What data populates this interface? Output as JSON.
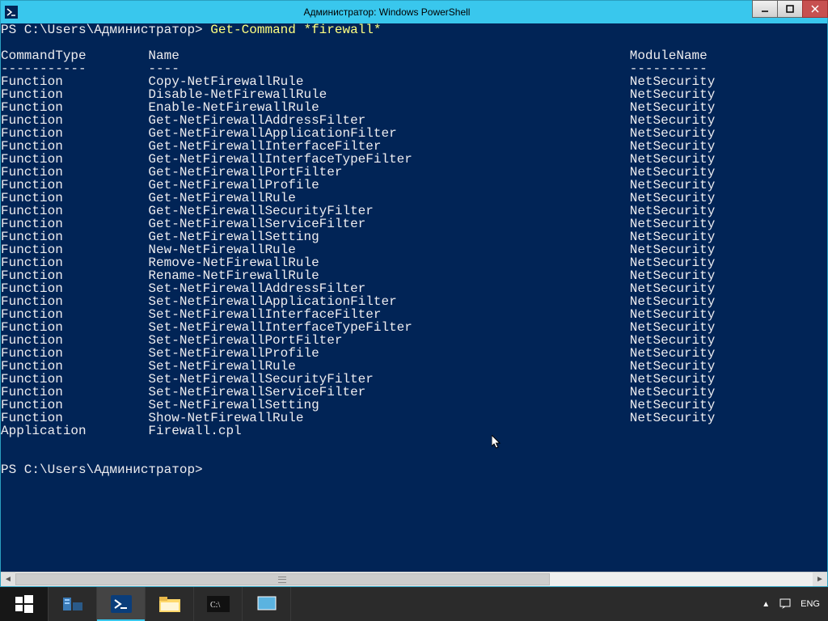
{
  "window": {
    "title": "Администратор: Windows PowerShell"
  },
  "terminal": {
    "prompt": "PS C:\\Users\\Администратор>",
    "command": "Get-Command *firewall*",
    "headers": {
      "col1": "CommandType",
      "col2": "Name",
      "col3": "ModuleName"
    },
    "dashes": {
      "col1": "-----------",
      "col2": "----",
      "col3": "----------"
    },
    "rows": [
      {
        "type": "Function",
        "name": "Copy-NetFirewallRule",
        "module": "NetSecurity"
      },
      {
        "type": "Function",
        "name": "Disable-NetFirewallRule",
        "module": "NetSecurity"
      },
      {
        "type": "Function",
        "name": "Enable-NetFirewallRule",
        "module": "NetSecurity"
      },
      {
        "type": "Function",
        "name": "Get-NetFirewallAddressFilter",
        "module": "NetSecurity"
      },
      {
        "type": "Function",
        "name": "Get-NetFirewallApplicationFilter",
        "module": "NetSecurity"
      },
      {
        "type": "Function",
        "name": "Get-NetFirewallInterfaceFilter",
        "module": "NetSecurity"
      },
      {
        "type": "Function",
        "name": "Get-NetFirewallInterfaceTypeFilter",
        "module": "NetSecurity"
      },
      {
        "type": "Function",
        "name": "Get-NetFirewallPortFilter",
        "module": "NetSecurity"
      },
      {
        "type": "Function",
        "name": "Get-NetFirewallProfile",
        "module": "NetSecurity"
      },
      {
        "type": "Function",
        "name": "Get-NetFirewallRule",
        "module": "NetSecurity"
      },
      {
        "type": "Function",
        "name": "Get-NetFirewallSecurityFilter",
        "module": "NetSecurity"
      },
      {
        "type": "Function",
        "name": "Get-NetFirewallServiceFilter",
        "module": "NetSecurity"
      },
      {
        "type": "Function",
        "name": "Get-NetFirewallSetting",
        "module": "NetSecurity"
      },
      {
        "type": "Function",
        "name": "New-NetFirewallRule",
        "module": "NetSecurity"
      },
      {
        "type": "Function",
        "name": "Remove-NetFirewallRule",
        "module": "NetSecurity"
      },
      {
        "type": "Function",
        "name": "Rename-NetFirewallRule",
        "module": "NetSecurity"
      },
      {
        "type": "Function",
        "name": "Set-NetFirewallAddressFilter",
        "module": "NetSecurity"
      },
      {
        "type": "Function",
        "name": "Set-NetFirewallApplicationFilter",
        "module": "NetSecurity"
      },
      {
        "type": "Function",
        "name": "Set-NetFirewallInterfaceFilter",
        "module": "NetSecurity"
      },
      {
        "type": "Function",
        "name": "Set-NetFirewallInterfaceTypeFilter",
        "module": "NetSecurity"
      },
      {
        "type": "Function",
        "name": "Set-NetFirewallPortFilter",
        "module": "NetSecurity"
      },
      {
        "type": "Function",
        "name": "Set-NetFirewallProfile",
        "module": "NetSecurity"
      },
      {
        "type": "Function",
        "name": "Set-NetFirewallRule",
        "module": "NetSecurity"
      },
      {
        "type": "Function",
        "name": "Set-NetFirewallSecurityFilter",
        "module": "NetSecurity"
      },
      {
        "type": "Function",
        "name": "Set-NetFirewallServiceFilter",
        "module": "NetSecurity"
      },
      {
        "type": "Function",
        "name": "Set-NetFirewallSetting",
        "module": "NetSecurity"
      },
      {
        "type": "Function",
        "name": "Show-NetFirewallRule",
        "module": "NetSecurity"
      },
      {
        "type": "Application",
        "name": "Firewall.cpl",
        "module": ""
      }
    ],
    "end_prompt": "PS C:\\Users\\Администратор>"
  },
  "tray": {
    "lang": "ENG"
  },
  "columns": {
    "w1": 19,
    "w2": 62
  }
}
